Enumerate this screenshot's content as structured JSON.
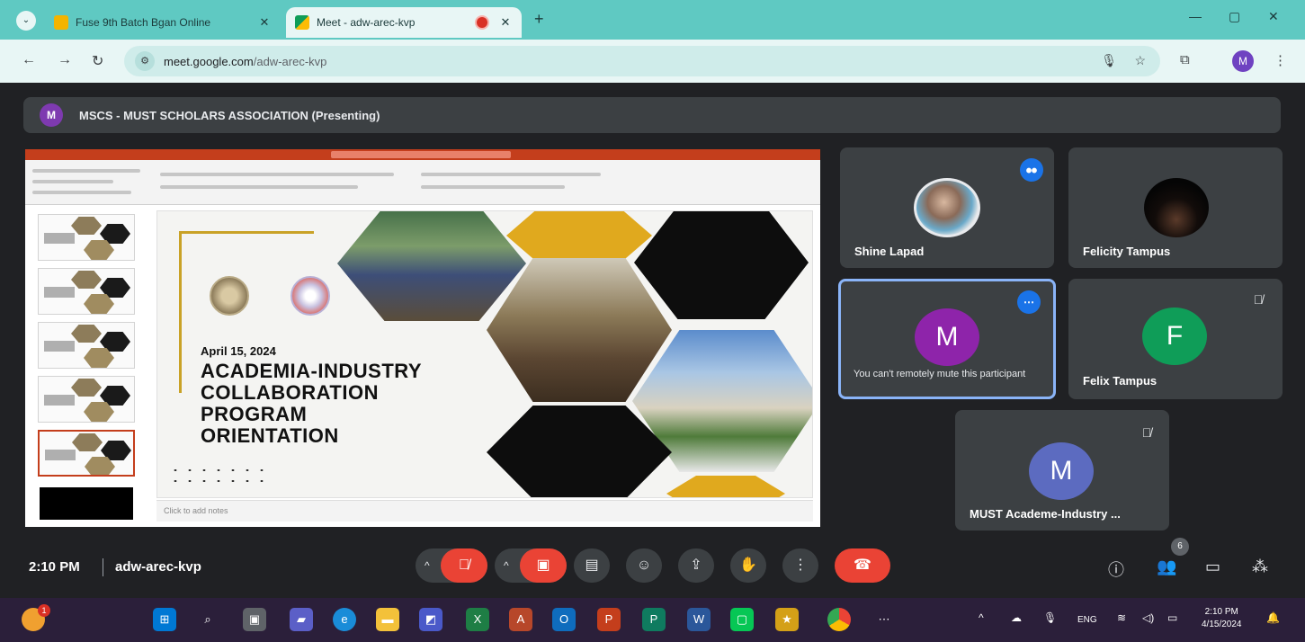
{
  "browser": {
    "tabs": [
      {
        "title": "Fuse 9th Batch Bgan Online",
        "active": false
      },
      {
        "title": "Meet - adw-arec-kvp",
        "active": true
      }
    ],
    "url_host": "meet.google.com",
    "url_path": "/adw-arec-kvp",
    "profile_initial": "M"
  },
  "meet": {
    "presenter_initial": "M",
    "presenter_text": "MSCS - MUST SCHOLARS ASSOCIATION (Presenting)",
    "slide": {
      "date": "April 15, 2024",
      "title_lines": [
        "ACADEMIA-INDUSTRY",
        "COLLABORATION",
        "PROGRAM",
        "ORIENTATION"
      ],
      "notes_placeholder": "Click to add notes"
    },
    "participants": [
      {
        "name": "Shine Lapad",
        "speaking": true
      },
      {
        "name": "Felicity Tampus"
      },
      {
        "initial": "M",
        "note": "You can't remotely mute this participant",
        "color": "#8e24aa"
      },
      {
        "initial": "F",
        "name": "Felix Tampus",
        "muted": true,
        "color": "#0f9d58"
      },
      {
        "initial": "M",
        "name": "MUST Academe-Industry ...",
        "muted": true,
        "color": "#5c6bc0"
      }
    ],
    "time": "2:10 PM",
    "meeting_code": "adw-arec-kvp",
    "people_count": "6"
  },
  "taskbar": {
    "notification_count": "1",
    "tray": {
      "lang": "ENG",
      "time": "2:10 PM",
      "date": "4/15/2024"
    }
  }
}
